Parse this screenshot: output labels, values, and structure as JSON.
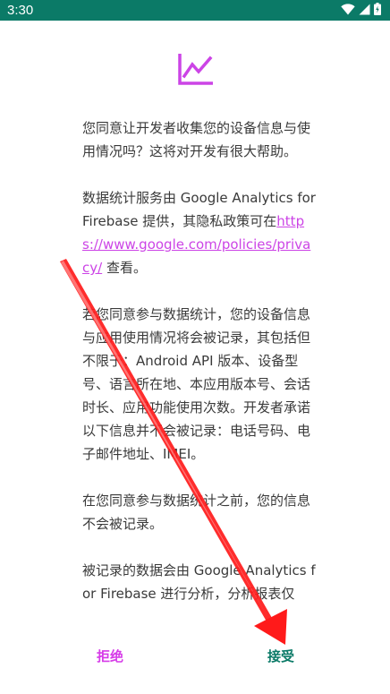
{
  "status_bar": {
    "time": "3:30",
    "bg_color": "#0b7a67",
    "icons": [
      "wifi-icon",
      "signal-icon",
      "battery-icon"
    ]
  },
  "header": {
    "icon": "trending-chart-icon",
    "icon_color": "#cc44e6"
  },
  "dialog": {
    "paragraph_1": "您同意让开发者收集您的设备信息与使用情况吗？这将对开发有很大帮助。",
    "paragraph_2_before_link": "数据统计服务由 Google Analytics for Firebase 提供，其隐私政策可在",
    "paragraph_2_link": "https://www.google.com/policies/privacy/",
    "paragraph_2_after_link": " 查看。",
    "paragraph_3": "若您同意参与数据统计，您的设备信息与应用使用情况将会被记录，其包括但不限于：Android API 版本、设备型号、语言所在地、本应用版本号、会话时长、应用功能使用次数。开发者承诺以下信息并不会被记录：电话号码、电子邮件地址、IMEI。",
    "paragraph_4": "在您同意参与数据统计之前，您的信息不会被记录。",
    "paragraph_5": "被记录的数据会由 Google Analytics for Firebase 进行分析，分析报表仅",
    "link_color": "#cc44e6"
  },
  "buttons": {
    "decline_label": "拒绝",
    "accept_label": "接受",
    "decline_color": "#d63be8",
    "accept_color": "#0b7a67"
  },
  "annotation": {
    "type": "arrow",
    "color": "#ff1a1a",
    "target": "accept-button"
  }
}
